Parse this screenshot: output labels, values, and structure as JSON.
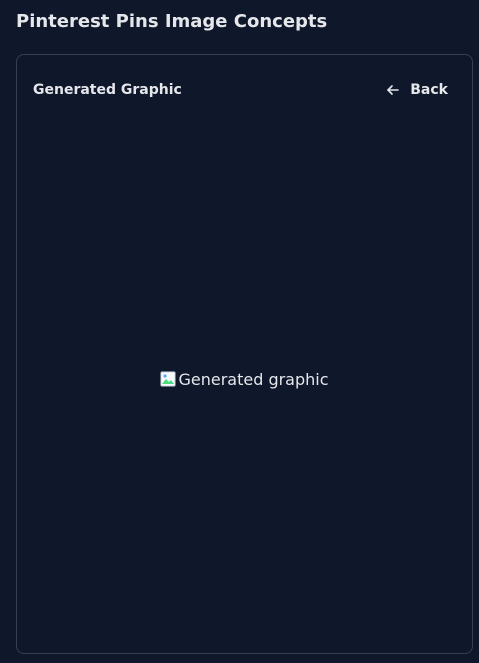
{
  "page": {
    "title": "Pinterest Pins Image Concepts"
  },
  "card": {
    "title": "Generated Graphic",
    "back_label": "Back",
    "back_icon": "arrow-left-icon"
  },
  "image": {
    "alt_text": "Generated graphic",
    "icon": "broken-image-icon"
  },
  "colors": {
    "background": "#0f172a",
    "border": "#334155",
    "text": "#e5e7eb"
  }
}
